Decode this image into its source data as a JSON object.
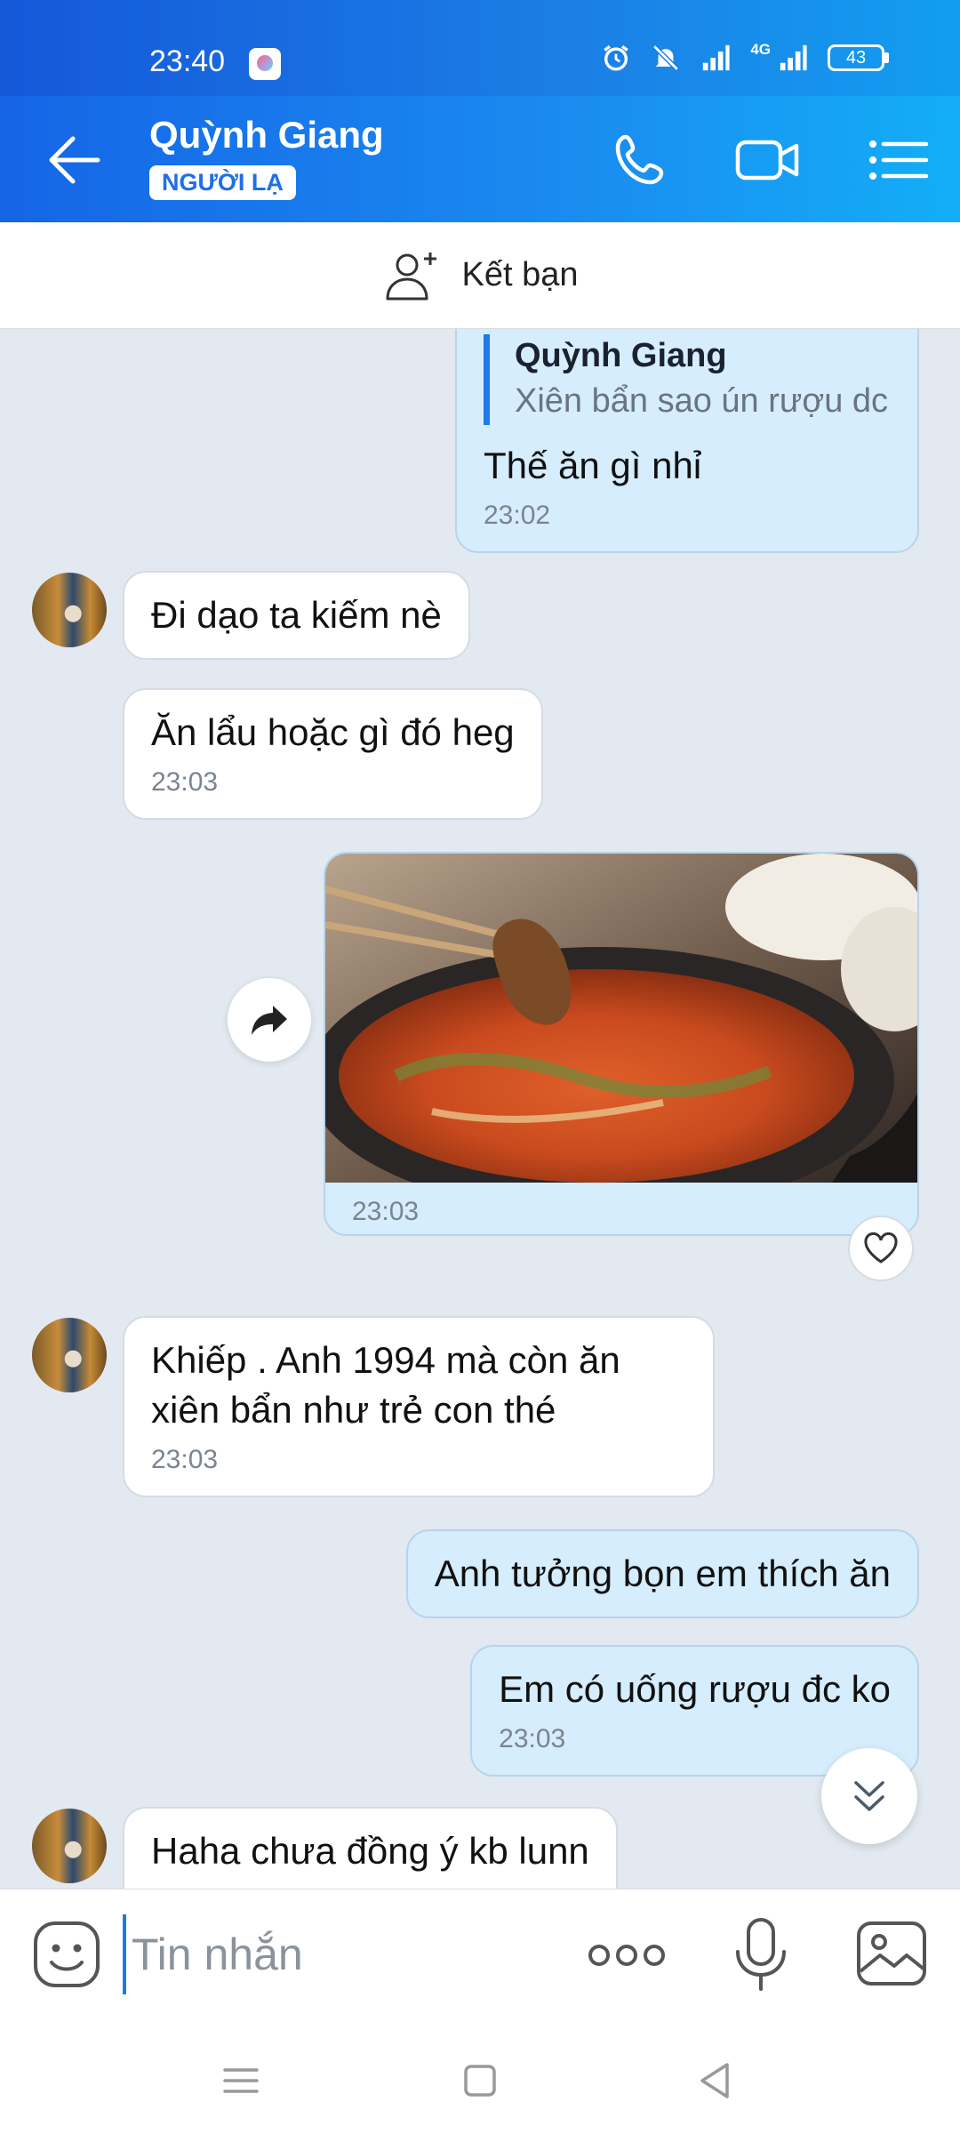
{
  "status_bar": {
    "time": "23:40",
    "network": "4G",
    "battery": "43"
  },
  "header": {
    "contact_name": "Quỳnh Giang",
    "badge": "NGƯỜI LẠ",
    "icons": [
      "back-arrow-icon",
      "phone-icon",
      "video-call-icon",
      "menu-list-icon"
    ]
  },
  "friend_bar": {
    "label": "Kết bạn",
    "icon": "add-friend-icon"
  },
  "messages": {
    "m1": {
      "direction": "outgoing",
      "reply_to_name": "Quỳnh Giang",
      "reply_to_text": "Xiên bẩn sao ún rượu dc",
      "text": "Thế ăn gì nhỉ",
      "time": "23:02"
    },
    "m2": {
      "direction": "incoming",
      "text": "Đi dạo ta kiếm nè"
    },
    "m3": {
      "direction": "incoming",
      "text": "Ăn lẩu hoặc gì đó heg",
      "time": "23:03"
    },
    "m4": {
      "direction": "outgoing",
      "type": "photo",
      "subject": "hotpot with skewers",
      "time": "23:03"
    },
    "m5": {
      "direction": "incoming",
      "text_line1": "Khiếp . Anh 1994 mà còn ăn",
      "text_line2": "xiên bẩn như trẻ con thé",
      "time": "23:03"
    },
    "m6": {
      "direction": "outgoing",
      "text": "Anh tưởng bọn em thích ăn"
    },
    "m7": {
      "direction": "outgoing",
      "text": "Em có uống rượu đc ko",
      "time": "23:03"
    },
    "m8": {
      "direction": "incoming",
      "text": "Haha chưa đồng ý kb lunn"
    }
  },
  "input_bar": {
    "placeholder": "Tin nhắn",
    "icons": [
      "emoji-icon",
      "more-options-icon",
      "microphone-icon",
      "image-icon"
    ]
  },
  "colors": {
    "header_start": "#1565e6",
    "header_end": "#13aef7",
    "outgoing_bubble": "#d5edfc",
    "incoming_bubble": "#ffffff",
    "chat_background": "#e2e9f1",
    "accent": "#1f7ae8"
  }
}
